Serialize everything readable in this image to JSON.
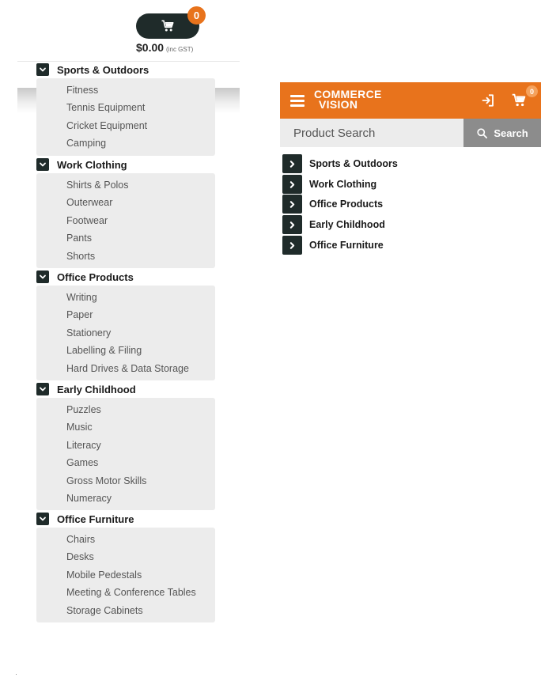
{
  "left_cart": {
    "count": "0",
    "total": "$0.00",
    "tax_note": "(inc GST)"
  },
  "left_menu": [
    {
      "title": "Sports & Outdoors",
      "items": [
        "Fitness",
        "Tennis Equipment",
        "Cricket Equipment",
        "Camping"
      ]
    },
    {
      "title": "Work Clothing",
      "items": [
        "Shirts & Polos",
        "Outerwear",
        "Footwear",
        "Pants",
        "Shorts"
      ]
    },
    {
      "title": "Office Products",
      "items": [
        "Writing",
        "Paper",
        "Stationery",
        "Labelling & Filing",
        "Hard Drives & Data Storage"
      ]
    },
    {
      "title": "Early Childhood",
      "items": [
        "Puzzles",
        "Music",
        "Literacy",
        "Games",
        "Gross Motor Skills",
        "Numeracy"
      ]
    },
    {
      "title": "Office Furniture",
      "items": [
        "Chairs",
        "Desks",
        "Mobile Pedestals",
        "Meeting & Conference Tables",
        "Storage Cabinets"
      ]
    }
  ],
  "mobile": {
    "logo_line1": "COMMERCE",
    "logo_line2": "VISION",
    "cart_count": "0",
    "search_placeholder": "Product Search",
    "search_button": "Search",
    "categories": [
      "Sports & Outdoors",
      "Work Clothing",
      "Office Products",
      "Early Childhood",
      "Office Furniture"
    ]
  },
  "colors": {
    "brand_orange": "#e8731c",
    "dark_teal": "#1f2b2a",
    "submenu_bg": "#ececec",
    "search_button_bg": "#8c8c8c"
  },
  "icons": [
    "cart-icon",
    "chevron-down-icon",
    "hamburger-icon",
    "login-icon",
    "search-icon",
    "chevron-right-icon"
  ]
}
